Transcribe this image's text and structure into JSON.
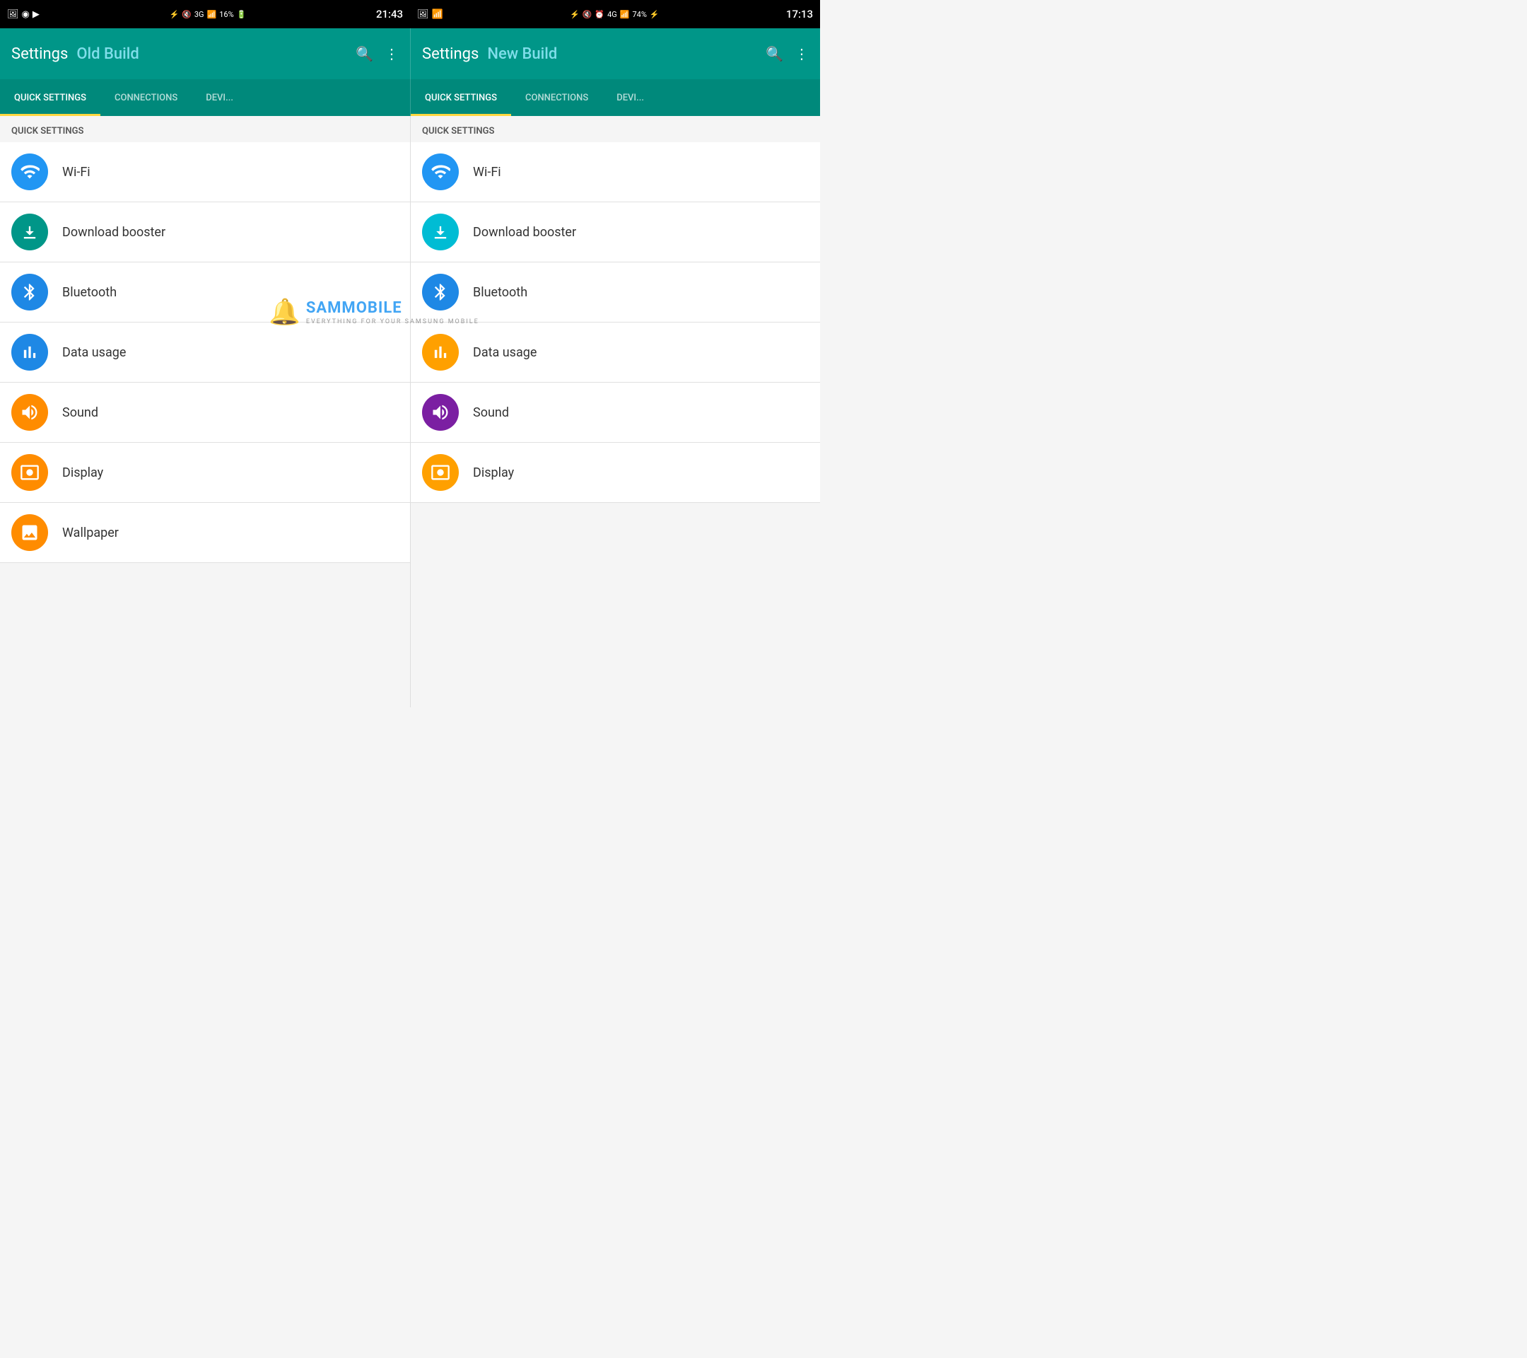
{
  "left": {
    "statusBar": {
      "time": "21:43",
      "battery": "16%",
      "network": "3G"
    },
    "header": {
      "title": "Settings",
      "buildLabel": "Old Build"
    },
    "tabs": [
      {
        "label": "QUICK SETTINGS",
        "active": true
      },
      {
        "label": "CONNECTIONS",
        "active": false
      },
      {
        "label": "DEVI...",
        "active": false
      }
    ],
    "sectionHeader": "QUICK SETTINGS",
    "items": [
      {
        "icon": "wifi",
        "label": "Wi-Fi",
        "iconColor": "blue"
      },
      {
        "icon": "bolt",
        "label": "Download booster",
        "iconColor": "teal"
      },
      {
        "icon": "bluetooth",
        "label": "Bluetooth",
        "iconColor": "blue-bt"
      },
      {
        "icon": "bar-chart",
        "label": "Data usage",
        "iconColor": "blue-data"
      },
      {
        "icon": "sound",
        "label": "Sound",
        "iconColor": "orange"
      },
      {
        "icon": "display",
        "label": "Display",
        "iconColor": "orange-display"
      },
      {
        "icon": "wallpaper",
        "label": "Wallpaper",
        "iconColor": "orange-wallpaper"
      }
    ]
  },
  "right": {
    "statusBar": {
      "time": "17:13",
      "battery": "74%",
      "network": "4G"
    },
    "header": {
      "title": "Settings",
      "buildLabel": "New Build"
    },
    "tabs": [
      {
        "label": "QUICK SETTINGS",
        "active": true
      },
      {
        "label": "CONNECTIONS",
        "active": false
      },
      {
        "label": "DEVI...",
        "active": false
      }
    ],
    "sectionHeader": "QUICK SETTINGS",
    "items": [
      {
        "icon": "wifi",
        "label": "Wi-Fi",
        "iconColor": "blue-r"
      },
      {
        "icon": "bolt",
        "label": "Download booster",
        "iconColor": "teal-r"
      },
      {
        "icon": "bluetooth",
        "label": "Bluetooth",
        "iconColor": "blue-bt-r"
      },
      {
        "icon": "bar-chart",
        "label": "Data usage",
        "iconColor": "yellow-data"
      },
      {
        "icon": "sound",
        "label": "Sound",
        "iconColor": "purple"
      },
      {
        "icon": "display",
        "label": "Display",
        "iconColor": "yellow-display"
      }
    ]
  },
  "watermark": {
    "text": "SAMM",
    "textBlue": "OBILE",
    "sub": "EVERYTHING FOR YOUR SAMSUNG MOBILE"
  }
}
